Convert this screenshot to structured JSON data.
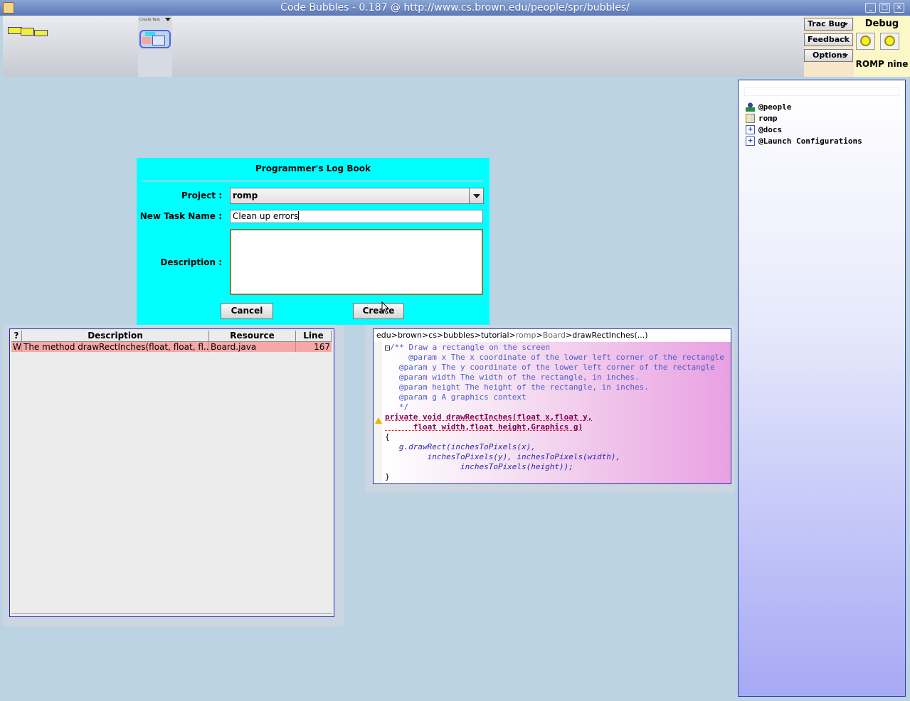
{
  "window": {
    "title": "Code Bubbles - 0.187 @ http://www.cs.brown.edu/people/spr/bubbles/"
  },
  "top_bar": {
    "buttons": [
      "Trac Bug",
      "Feedback",
      "Options"
    ],
    "task_label": "Create Task",
    "debug_title": "Debug",
    "session_name": "ROMP nine"
  },
  "package_explorer": {
    "items": [
      {
        "label": "@people",
        "icon": "people-icon"
      },
      {
        "label": "romp",
        "icon": "project-icon"
      },
      {
        "label": "@docs",
        "icon": "expand-icon"
      },
      {
        "label": "@Launch Configurations",
        "icon": "expand-icon"
      }
    ]
  },
  "log_book": {
    "title": "Programmer's Log Book",
    "project_label": "Project :",
    "project_value": "romp",
    "task_name_label": "New Task Name :",
    "task_name_value": "Clean up errors",
    "description_label": "Description :",
    "description_value": "",
    "cancel_label": "Cancel",
    "create_label": "Create"
  },
  "problems": {
    "columns": [
      "?",
      "Description",
      "Resource",
      "Line"
    ],
    "rows": [
      {
        "type": "W",
        "description": "The method drawRectInches(float, float, fl...",
        "resource": "Board.java",
        "line": "167"
      }
    ]
  },
  "code_bubble": {
    "breadcrumb": [
      "edu",
      "brown",
      "cs",
      "bubbles",
      "tutorial",
      "romp",
      "Board",
      "drawRectInches(...)"
    ],
    "lines": [
      "/** Draw a rectangle on the screen",
      "     @param x The x coordinate of the lower left corner of the rectangle",
      "   @param y The y coordinate of the lower left corner of the rectangle",
      "   @param width The width of the rectangle, in inches.",
      "   @param height The height of the rectangle, in inches.",
      "   @param g A graphics context",
      "   */",
      "private void drawRectInches(float x,float y,",
      "      float width,float height,Graphics g)",
      "{",
      "   g.drawRect(inchesToPixels(x),",
      "         inchesToPixels(y), inchesToPixels(width),",
      "                inchesToPixels(height));",
      "}"
    ]
  }
}
